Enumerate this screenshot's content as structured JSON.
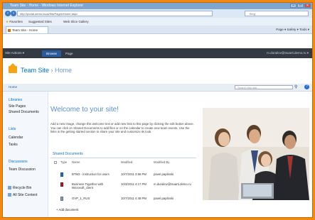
{
  "browser": {
    "title": "Team Site - Home - Windows Internet Explorer",
    "address": "http://portal.demo.local/SitePages/Home.aspx",
    "search_placeholder": "Bing",
    "favorites_label": "Favorites",
    "suggested_sites": "Suggested Sites",
    "web_slice": "Web Slice Gallery",
    "tab_title": "Team Site - Home",
    "command_bar": "Page ▾   Safety ▾   Tools ▾",
    "colors": {
      "frame": "#f08a14",
      "accent": "#0072c6"
    }
  },
  "sharepoint": {
    "site_actions": "Site Actions ▾",
    "ribbon_tabs": [
      "Browse",
      "Page"
    ],
    "active_tab": "Browse",
    "user": "m.durailov@tsuarti.demo.ru ▾",
    "site_title": "Team Site",
    "title_sep": " › ",
    "page_title": "Home",
    "breadcrumb": "Home",
    "search_placeholder": "Search this site..."
  },
  "leftnav": {
    "sections": [
      {
        "title": "Libraries",
        "items": [
          "Site Pages",
          "Shared Documents"
        ]
      },
      {
        "title": "Lists",
        "items": [
          "Calendar",
          "Tasks"
        ]
      },
      {
        "title": "Discussions",
        "items": [
          "Team Discussion"
        ]
      }
    ],
    "bottom": [
      "Recycle Bin",
      "All Site Content"
    ]
  },
  "main": {
    "welcome": "Welcome to your site!",
    "intro": "Add a new image, change this welcome text or add new lists to this page by clicking the edit button above. You can click on Shared Documents to add files or on the calendar to create new team events. Use the links in the getting started section to share your site and customize its look.",
    "shared_docs_title": "Shared Documents",
    "columns": [
      "Type",
      "Name",
      "Modified",
      "Modified By"
    ],
    "documents": [
      {
        "name": "BTM2 - instruction for users",
        "modified": "10/7/2011 3:56 PM",
        "by": "pavel.paplinski",
        "icon": "word"
      },
      {
        "name": "Business Together with Microsoft_client",
        "modified": "10/3/2011 4:17 PM",
        "by": "m.durailov@tsuarti.demo.ru",
        "icon": "ppt"
      },
      {
        "name": "OVP_1_RUS",
        "modified": "10/7/2011 4:48 PM",
        "by": "pavel.paplinski",
        "icon": "doc"
      }
    ],
    "add_document": "Add document"
  }
}
